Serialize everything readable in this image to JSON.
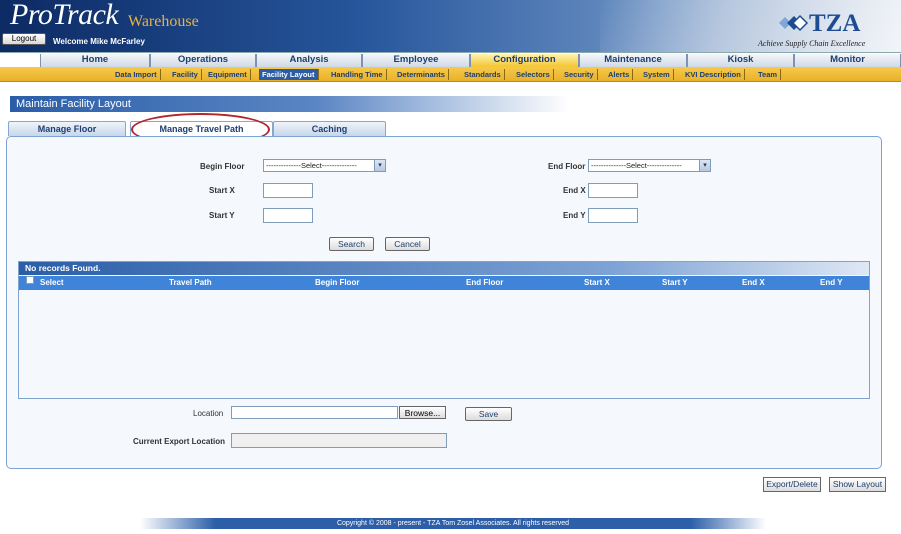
{
  "header": {
    "logo_main": "ProTrack",
    "logo_sub": "Warehouse",
    "logout_label": "Logout",
    "welcome": "Welcome Mike McFarley",
    "brand": "TZA",
    "tagline": "Achieve Supply Chain Excellence"
  },
  "main_nav": [
    "Home",
    "Operations",
    "Analysis",
    "Employee",
    "Configuration",
    "Maintenance",
    "Kiosk",
    "Monitor"
  ],
  "main_nav_active": "Configuration",
  "sub_nav": [
    "Data Import",
    "Facility",
    "Equipment",
    "Facility Layout",
    "Handling Time",
    "Determinants",
    "Standards",
    "Selectors",
    "Security",
    "Alerts",
    "System",
    "KVI Description",
    "Team"
  ],
  "sub_nav_active": "Facility Layout",
  "page_title": "Maintain Facility Layout",
  "page_tabs": [
    "Manage Floor",
    "Manage Travel Path",
    "Caching"
  ],
  "page_tabs_active": "Manage Travel Path",
  "form": {
    "begin_floor_label": "Begin Floor",
    "begin_floor_value": "--------------Select--------------",
    "end_floor_label": "End Floor",
    "end_floor_value": "--------------Select--------------",
    "start_x_label": "Start X",
    "start_y_label": "Start Y",
    "end_x_label": "End X",
    "end_y_label": "End Y",
    "search_label": "Search",
    "cancel_label": "Cancel"
  },
  "grid": {
    "caption": "No records Found.",
    "columns": [
      "Select",
      "Travel Path",
      "Begin Floor",
      "End Floor",
      "Start X",
      "Start Y",
      "End X",
      "End Y"
    ]
  },
  "export": {
    "location_label": "Location",
    "browse_label": "Browse...",
    "save_label": "Save",
    "current_location_label": "Current Export Location",
    "export_delete_label": "Export/Delete",
    "show_layout_label": "Show Layout"
  },
  "footer": "Copyright © 2008 - present - TZA Tom Zosel Associates. All rights reserved",
  "colors": {
    "accent_blue": "#2b5ea8",
    "active_tab_yellow": "#f3c530",
    "highlight_ring": "#b0262e"
  }
}
